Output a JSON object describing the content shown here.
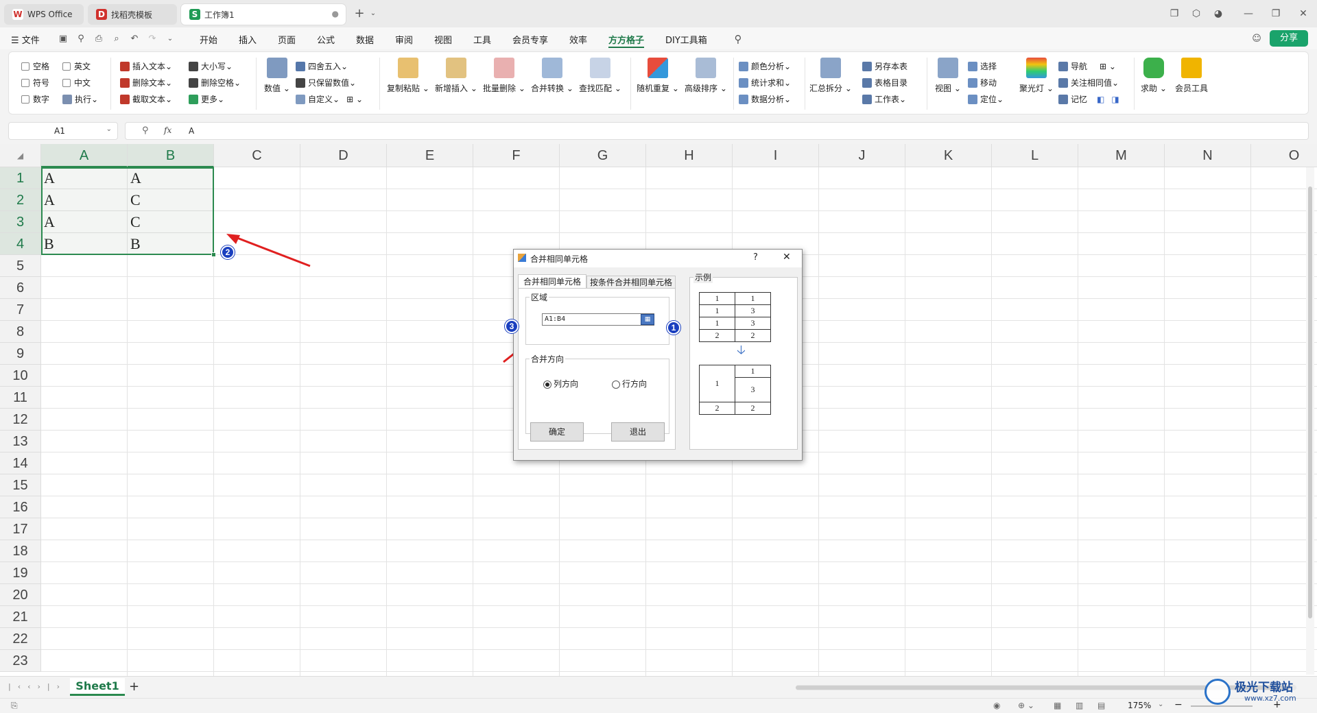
{
  "tabs": [
    {
      "label": "WPS Office",
      "logo": "W",
      "logo_color": "#d0312d"
    },
    {
      "label": "找稻壳模板",
      "logo": "D",
      "logo_color": "#d0312d"
    },
    {
      "label": "工作簿1",
      "logo": "S",
      "logo_color": "#1f9a55"
    }
  ],
  "menu": {
    "file": "文件",
    "items": [
      "开始",
      "插入",
      "页面",
      "公式",
      "数据",
      "审阅",
      "视图",
      "工具",
      "会员专享",
      "效率",
      "方方格子",
      "DIY工具箱"
    ],
    "active": "方方格子",
    "share": "分享"
  },
  "ribbon": {
    "checks": [
      "空格",
      "英文",
      "符号",
      "中文",
      "数字"
    ],
    "exec": "执行",
    "text_group": [
      "插入文本",
      "删除文本",
      "截取文本"
    ],
    "case_group": [
      "大小写",
      "删除空格",
      "更多"
    ],
    "number": "数值",
    "round_group": [
      "四舍五入",
      "只保留数值",
      "自定义"
    ],
    "big_buttons_1": [
      "复制粘贴",
      "新增插入",
      "批量删除",
      "合并转换",
      "查找匹配"
    ],
    "big_buttons_2": [
      "随机重复",
      "高级排序"
    ],
    "analysis_group": [
      "颜色分析",
      "统计求和",
      "数据分析"
    ],
    "split": "汇总拆分",
    "save_group": [
      "另存本表",
      "表格目录",
      "工作表"
    ],
    "view": "视图",
    "select_group": [
      "选择",
      "移动",
      "定位"
    ],
    "spotlight": "聚光灯",
    "nav_group": [
      "导航",
      "关注相同值",
      "记忆"
    ],
    "help": "求助",
    "member": "会员工具"
  },
  "formula_bar": {
    "cell_ref": "A1",
    "fx": "fx",
    "value": "A"
  },
  "columns": [
    "A",
    "B",
    "C",
    "D",
    "E",
    "F",
    "G",
    "H",
    "I",
    "J",
    "K",
    "L",
    "M",
    "N",
    "O"
  ],
  "rows": [
    "1",
    "2",
    "3",
    "4",
    "5",
    "6",
    "7",
    "8",
    "9",
    "10",
    "11",
    "12",
    "13",
    "14",
    "15",
    "16",
    "17",
    "18",
    "19",
    "20",
    "21",
    "22",
    "23"
  ],
  "cells": [
    [
      "A",
      "A"
    ],
    [
      "A",
      "C"
    ],
    [
      "A",
      "C"
    ],
    [
      "B",
      "B"
    ]
  ],
  "dialog": {
    "title": "合并相同单元格",
    "help": "?",
    "close": "✕",
    "tab1": "合并相同单元格",
    "tab2": "按条件合并相同单元格",
    "range_label": "区域",
    "range_value": "A1:B4",
    "direction_label": "合并方向",
    "radio_col": "列方向",
    "radio_row": "行方向",
    "ok": "确定",
    "exit": "退出",
    "example_label": "示例",
    "example_before": [
      [
        "1",
        "1"
      ],
      [
        "1",
        "3"
      ],
      [
        "1",
        "3"
      ],
      [
        "2",
        "2"
      ]
    ],
    "example_after": {
      "merged": "1",
      "right": [
        "1",
        "3"
      ],
      "last": [
        "2",
        "2"
      ]
    }
  },
  "annotations": [
    "1",
    "2",
    "3"
  ],
  "sheet": {
    "name": "Sheet1",
    "add": "+"
  },
  "status": {
    "zoom": "175%"
  },
  "watermark": {
    "text": "极光下载站",
    "url": "www.xz7.com"
  }
}
